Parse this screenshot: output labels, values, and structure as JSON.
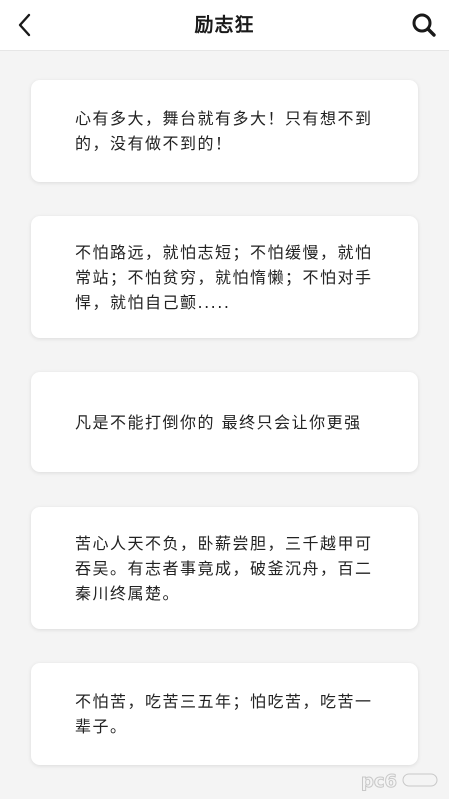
{
  "header": {
    "title": "励志狂",
    "back_icon": "chevron-left-icon",
    "search_icon": "search-icon"
  },
  "quotes": [
    {
      "text": "心有多大，舞台就有多大！只有想不到的，没有做不到的！"
    },
    {
      "text": "不怕路远，就怕志短；不怕缓慢，就怕常站；不怕贫穷，就怕惰懒；不怕对手悍，就怕自己颤....."
    },
    {
      "text": "凡是不能打倒你的 最终只会让你更强"
    },
    {
      "text": "苦心人天不负，卧薪尝胆，三千越甲可吞吴。有志者事竟成，破釜沉舟，百二秦川终属楚。"
    },
    {
      "text": "不怕苦，吃苦三五年；怕吃苦，吃苦一辈子。"
    }
  ],
  "watermark": {
    "text": "pc6"
  }
}
